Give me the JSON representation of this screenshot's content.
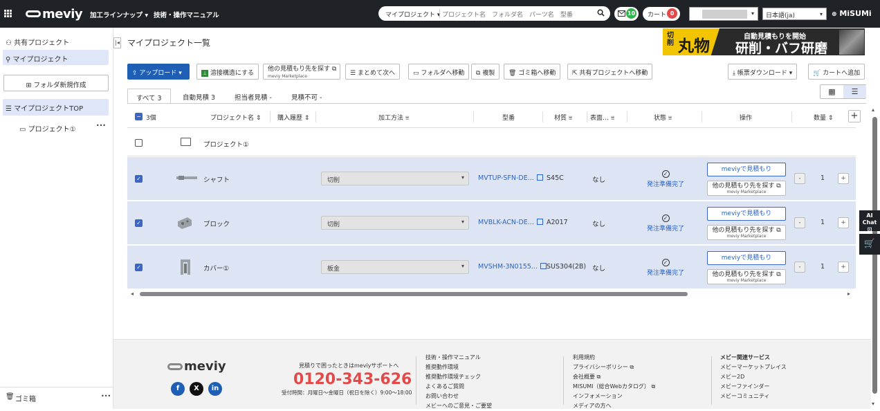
{
  "header": {
    "logo": "meviy",
    "nav_lineup": "加工ラインナップ",
    "nav_manual": "技術・操作マニュアル",
    "search_scope": "マイプロジェクト",
    "search_placeholder": "プロジェクト名　フォルダ名　パーツ名　型番",
    "mail_count": "10",
    "cart_label": "カート",
    "cart_count": "0",
    "language": "日本語(ja)",
    "brand": "MiSUMi"
  },
  "sidebar": {
    "shared_projects": "共有プロジェクト",
    "my_projects": "マイプロジェクト",
    "new_folder": "フォルダ新規作成",
    "tree_top": "マイプロジェクトTOP",
    "tree_child": "プロジェクト①",
    "more": "•••",
    "trash": "ゴミ箱",
    "trash_more": "•••"
  },
  "main": {
    "title": "マイプロジェクト一覧",
    "banner": {
      "small": "切削",
      "big": "丸物",
      "line1": "自動見積もりを開始",
      "line2": "研削・バフ研磨"
    },
    "toolbar": {
      "upload": "アップロード",
      "weld": "溶接構造にする",
      "other_quote": "他の見積もり先を探す",
      "other_quote_sub": "meviy Marketplace",
      "batch_next": "まとめて次へ",
      "move_folder": "フォルダへ移動",
      "copy": "複製",
      "to_trash": "ゴミ箱へ移動",
      "move_shared": "共有プロジェクトへ移動",
      "report_download": "帳票ダウンロード",
      "add_cart": "カートへ追加"
    },
    "tabs": [
      {
        "label": "すべて 3"
      },
      {
        "label": "自動見積 3"
      },
      {
        "label": "担当者見積 -"
      },
      {
        "label": "見積不可 -"
      }
    ],
    "table": {
      "headers": {
        "count": "3個",
        "project_name": "プロジェクト名 ⇕",
        "purchase_history": "購入履歴 ⇕",
        "method": "加工方法 ⩸",
        "part_no": "型番",
        "material": "材質 ⩸",
        "surface": "表面… ⩸",
        "status": "状態 ⩸",
        "actions": "操作",
        "qty": "数量 ⇕"
      },
      "folder_row": {
        "name": "プロジェクト①"
      },
      "rows": [
        {
          "name": "シャフト",
          "method": "切削",
          "part_no": "MVTUP-SFN-DE...",
          "material": "S45C",
          "surface": "なし",
          "status": "発注準備完了",
          "meviy_btn": "meviyで見積もり",
          "other_btn": "他の見積もり先を探す",
          "other_sub": "meviy Marketplace",
          "qty": "1"
        },
        {
          "name": "ブロック",
          "method": "切削",
          "part_no": "MVBLK-ACN-DE...",
          "material": "A2017",
          "surface": "なし",
          "status": "発注準備完了",
          "meviy_btn": "meviyで見積もり",
          "other_btn": "他の見積もり先を探す",
          "other_sub": "meviy Marketplace",
          "qty": "1"
        },
        {
          "name": "カバー①",
          "method": "板金",
          "part_no": "MVSHM-3N0155...",
          "material": "SUS304(2B)",
          "surface": "なし",
          "status": "発注準備完了",
          "meviy_btn": "meviyで見積もり",
          "other_btn": "他の見積もり先を探す",
          "other_sub": "meviy Marketplace",
          "qty": "1"
        }
      ]
    }
  },
  "footer": {
    "logo": "meviy",
    "support_note": "見積りで困ったときはmeviyサポートへ",
    "phone": "0120-343-626",
    "hours": "受付時間：月曜日～金曜日（祝日を除く）9:00～18:00",
    "col1": [
      "技術・操作マニュアル",
      "推奨動作環境",
      "推奨動作環境チェック",
      "よくあるご質問",
      "お問い合わせ",
      "メビーへのご意見・ご要望"
    ],
    "col2": [
      "利用規約",
      "プライバシーポリシー",
      "会社概要",
      "MISUMI（総合Webカタログ）",
      "インフォメーション",
      "メディアの方へ"
    ],
    "col3_title": "メビー関連サービス",
    "col3": [
      "メビーマーケットプレイス",
      "メビー2D",
      "メビーファインダー",
      "メビーコミュニティ"
    ]
  },
  "side": {
    "ai_chat": "AI Chat"
  },
  "colors": {
    "accent": "#1e5fb5",
    "link": "#2c63c7",
    "selected_row": "#dde5f5",
    "phone": "#e24a4a",
    "banner_yellow": "#f3c400"
  }
}
